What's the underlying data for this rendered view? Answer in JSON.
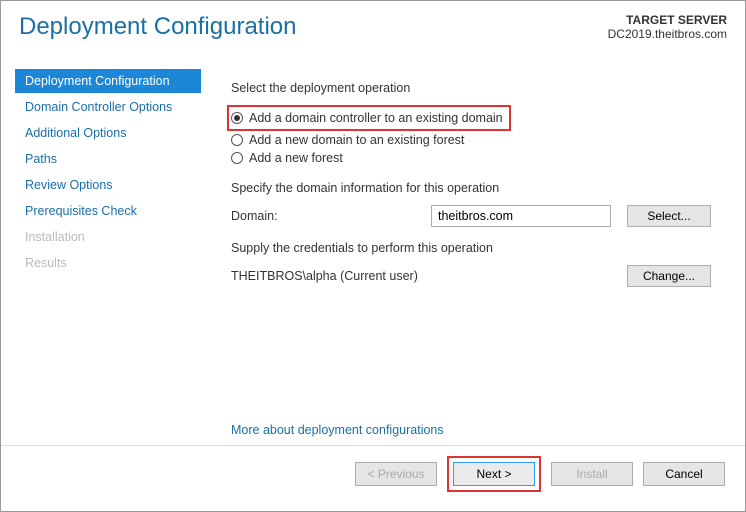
{
  "header": {
    "title": "Deployment Configuration",
    "target_label": "TARGET SERVER",
    "target_server": "DC2019.theitbros.com"
  },
  "sidebar": {
    "items": [
      {
        "label": "Deployment Configuration",
        "selected": true
      },
      {
        "label": "Domain Controller Options"
      },
      {
        "label": "Additional Options"
      },
      {
        "label": "Paths"
      },
      {
        "label": "Review Options"
      },
      {
        "label": "Prerequisites Check"
      },
      {
        "label": "Installation",
        "disabled": true
      },
      {
        "label": "Results",
        "disabled": true
      }
    ]
  },
  "content": {
    "select_operation_label": "Select the deployment operation",
    "radios": {
      "add_dc": "Add a domain controller to an existing domain",
      "add_domain": "Add a new domain to an existing forest",
      "add_forest": "Add a new forest"
    },
    "specify_info_label": "Specify the domain information for this operation",
    "domain_label": "Domain:",
    "domain_value": "theitbros.com",
    "select_button": "Select...",
    "credentials_label": "Supply the credentials to perform this operation",
    "credentials_value": "THEITBROS\\alpha (Current user)",
    "change_button": "Change...",
    "more_link": "More about deployment configurations"
  },
  "footer": {
    "previous": "< Previous",
    "next": "Next >",
    "install": "Install",
    "cancel": "Cancel"
  }
}
